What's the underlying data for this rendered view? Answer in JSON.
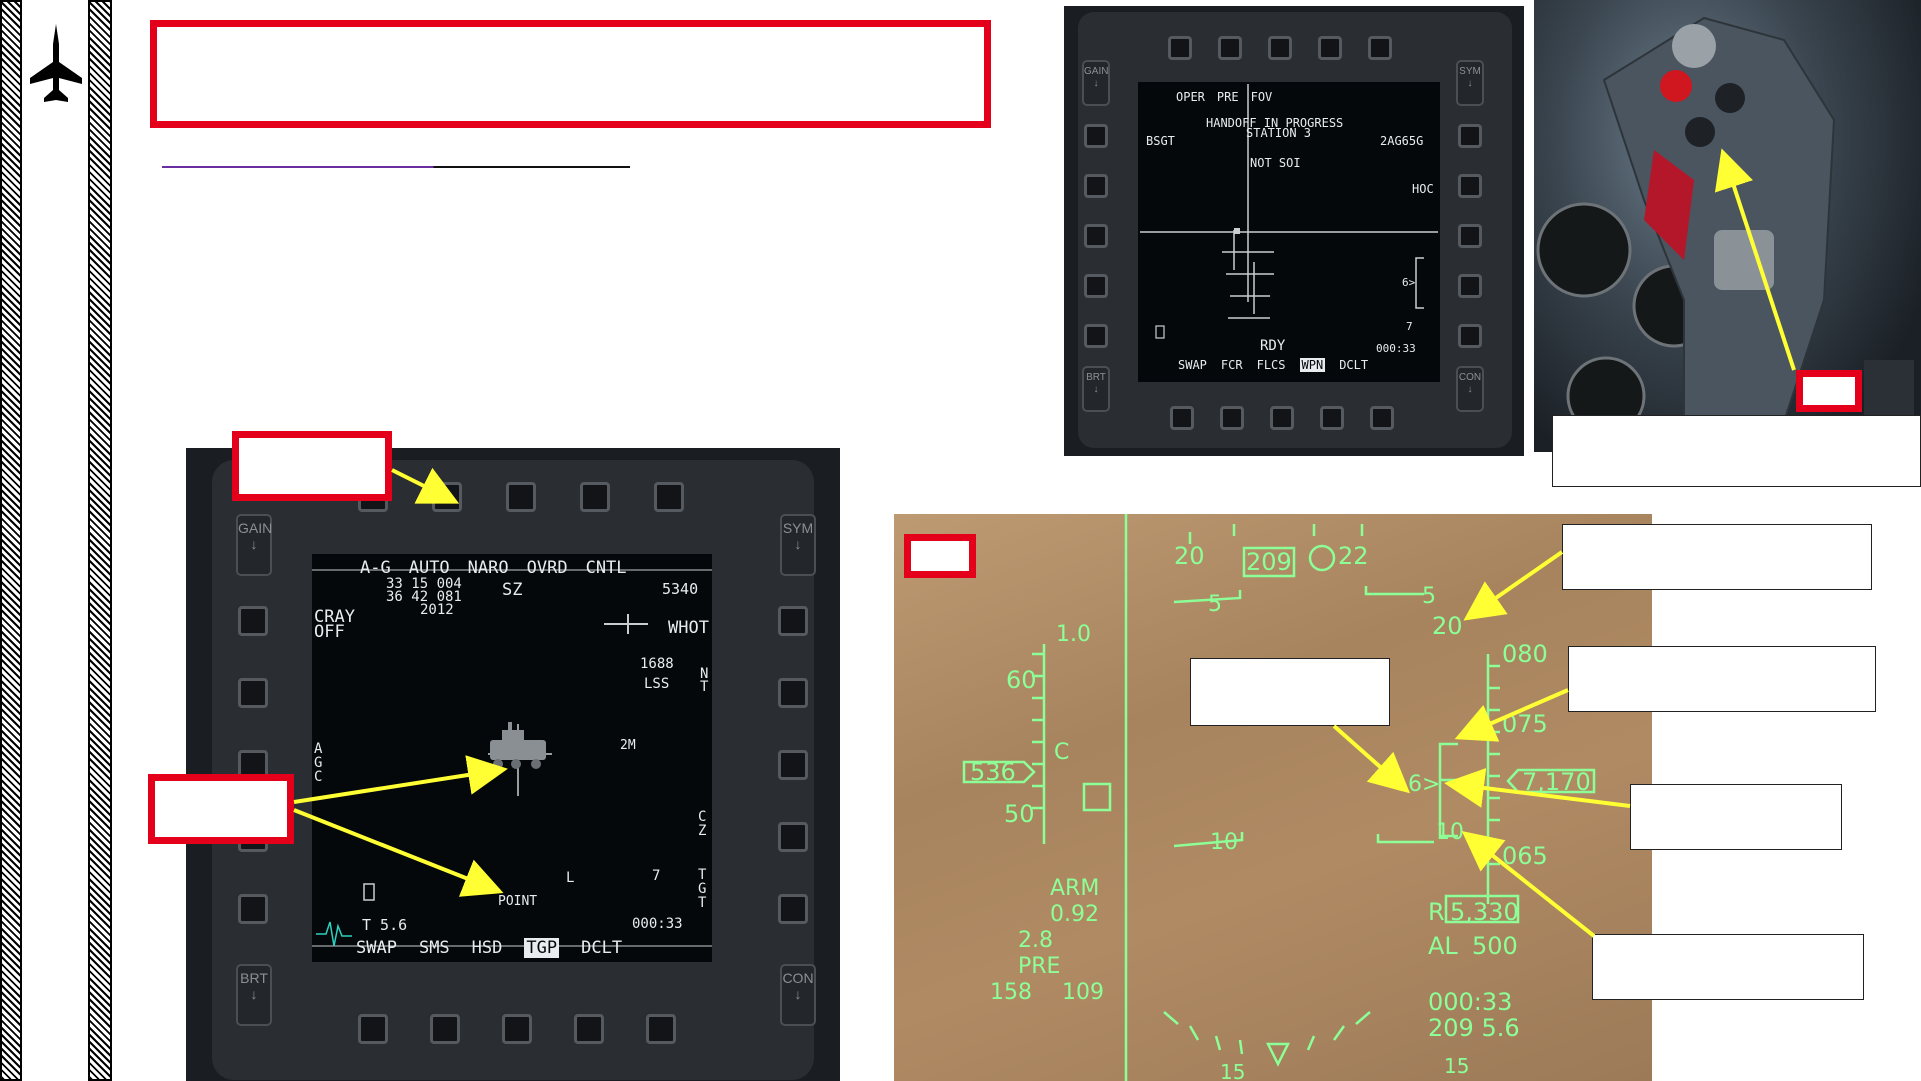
{
  "header": {
    "title": ""
  },
  "mfd_left": {
    "rockers": {
      "gain": "GAIN",
      "sym": "SYM",
      "brt": "BRT",
      "con": "CON"
    },
    "top_row": [
      "A-G",
      "AUTO",
      "NARO",
      "OVRD",
      "CNTL"
    ],
    "coords": [
      "33 15 004",
      "36 42 081"
    ],
    "year": "2012",
    "cray": "CRAY",
    "off": "OFF",
    "sz": "SZ",
    "altitude": "5340",
    "whot": "WHOT",
    "range": "1688",
    "lss": "LSS",
    "ntgt": "NT",
    "agc": "AGC",
    "two_m": "2M",
    "cz": "CZ",
    "tgt": "TGT",
    "point": "POINT",
    "l_marker": "L",
    "seven": "7",
    "t_value": "T 5.6",
    "time": "000:33",
    "bottom_row": [
      "SWAP",
      "SMS",
      "HSD",
      "TGP",
      "DCLT"
    ],
    "selected_bottom": "TGP"
  },
  "mfd_right": {
    "rockers": {
      "gain": "GAIN",
      "sym": "SYM",
      "brt": "BRT",
      "con": "CON"
    },
    "top_row": [
      "OPER",
      "PRE",
      "FOV"
    ],
    "status1": "HANDOFF IN PROGRESS",
    "status2": "STATION 3",
    "bsgt": "BSGT",
    "weapon": "2AG65G",
    "not_soi": "NOT SOI",
    "hoc": "HOC",
    "six_marker": "6>",
    "seven": "7",
    "rdy": "RDY",
    "time": "000:33",
    "bottom_row": [
      "SWAP",
      "FCR",
      "FLCS",
      "WPN",
      "DCLT"
    ],
    "selected_bottom": "WPN"
  },
  "hud": {
    "heading_left": "20",
    "heading_current": "209",
    "heading_right": "22",
    "pitch_5_left": "5",
    "pitch_5_right": "5",
    "pitch_20": "20",
    "g_value": "1.0",
    "speed_60": "60",
    "speed_current": "536",
    "speed_c": "C",
    "speed_50": "50",
    "alt_080": "080",
    "alt_075": "075",
    "alt_current": "7,170",
    "alt_065": "065",
    "six_marker": "6>",
    "pitch_10_left": "10",
    "pitch_10_right": "10",
    "arm": "ARM",
    "mach": "0.92",
    "val_28": "2.8",
    "pre": "PRE",
    "val_158": "158",
    "val_109": "109",
    "r_label": "R",
    "r_value": "5,330",
    "al_label": "AL",
    "al_value": "500",
    "time": "000:33",
    "bottom_right": "209 5.6",
    "bottom_15_left": "15",
    "bottom_15_right": "15"
  },
  "colors": {
    "red": "#e4001b",
    "hud_green": "#8dff97",
    "arrow_yellow": "#ffff33",
    "divider_purple": "#6a2ea0"
  }
}
